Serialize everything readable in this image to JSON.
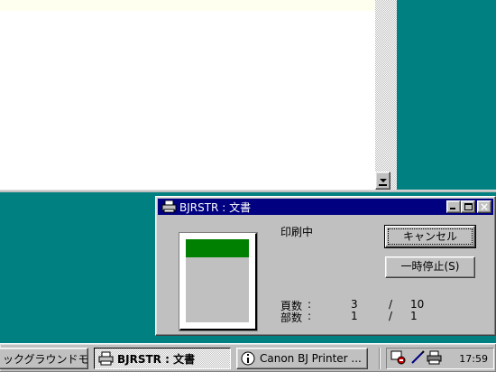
{
  "dialog": {
    "title": "BJRSTR : 文書",
    "status": "印刷中",
    "cancel_label": "キャンセル",
    "pause_label": "一時停止(S)",
    "pages": {
      "label": "頁数",
      "colon": ":",
      "current": "3",
      "slash": "/",
      "total": "10"
    },
    "copies": {
      "label": "部数",
      "colon": ":",
      "current": "1",
      "slash": "/",
      "total": "1"
    }
  },
  "taskbar": {
    "items": [
      {
        "label": "ックグラウンドモ..."
      },
      {
        "label": "BJRSTR : 文書",
        "icon": "printer-icon"
      },
      {
        "label": "Canon BJ Printer ...",
        "icon": "info-icon"
      }
    ],
    "clock": "17:59"
  },
  "colors": {
    "desktop": "#008080",
    "titlebar": "#000080",
    "preview_band": "#008000",
    "face": "#c0c0c0"
  }
}
